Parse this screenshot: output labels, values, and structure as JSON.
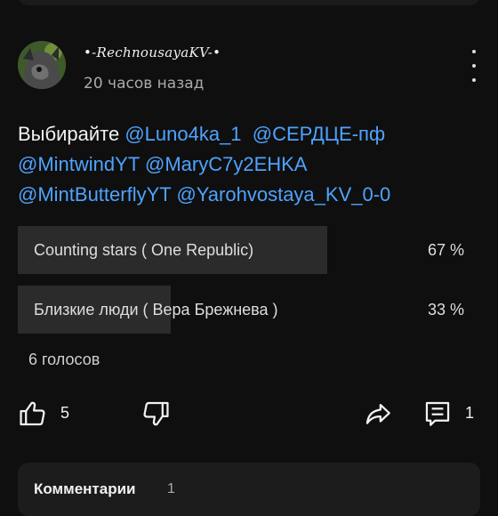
{
  "post": {
    "author": "•-RechnousayaKV-•",
    "timestamp": "20 часов назад",
    "intro": "Выбирайте",
    "mentions": [
      "@Luno4ka_1",
      "@СЕРДЦЕ-пф",
      "@MintwindYT",
      "@MaryC7y2EHKA",
      "@MintButterflyYT",
      "@Yarohvostaya_KV_0-0"
    ]
  },
  "poll": {
    "options": [
      {
        "label": "Counting stars ( One Republic)",
        "percent_text": "67 %",
        "percent": 67
      },
      {
        "label": "Близкие люди ( Вера Брежнева )",
        "percent_text": "33 %",
        "percent": 33
      }
    ],
    "votes": "6 голосов"
  },
  "actions": {
    "likes": "5",
    "comments_count": "1"
  },
  "comments": {
    "title": "Комментарии",
    "count": "1"
  },
  "icons": [
    "avatar",
    "more-vert-icon",
    "thumb-up-icon",
    "thumb-down-icon",
    "share-icon",
    "comment-icon"
  ],
  "colors": {
    "background": "#0f0f0f",
    "mention": "#4ea3ff",
    "poll_fill": "#2b2b2b",
    "muted": "#aaaaaa"
  }
}
